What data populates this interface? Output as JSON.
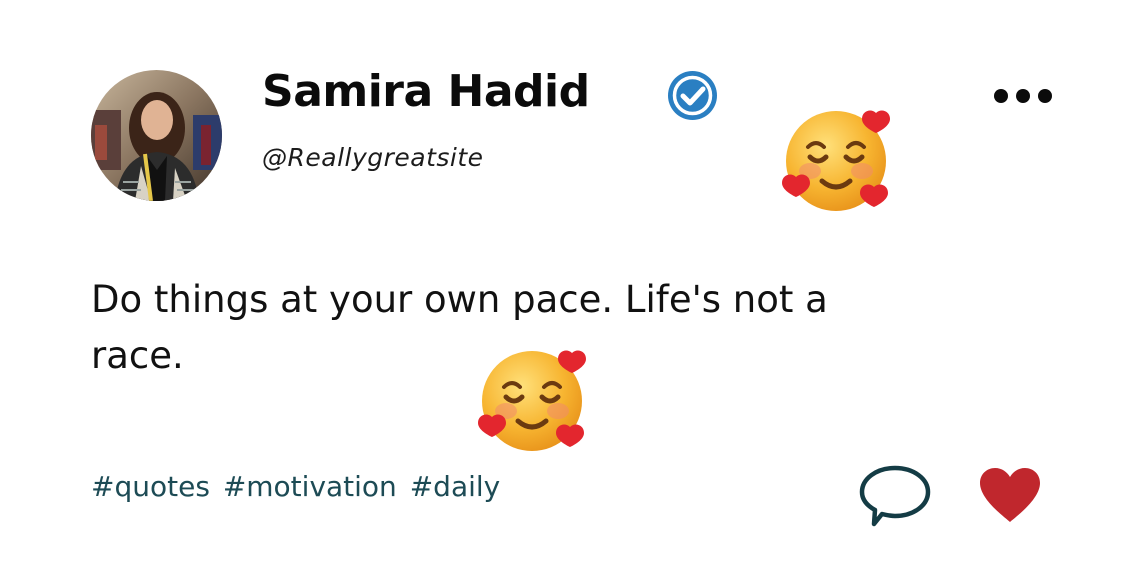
{
  "post": {
    "author_name": "Samira Hadid",
    "author_handle": "@Reallygreatsite",
    "verified": true,
    "text": "Do things at your own pace. Life's not a race.",
    "hashtags": [
      "#quotes",
      "#motivation",
      "#daily"
    ]
  },
  "icons": {
    "verified": "verified-badge-icon",
    "more": "more-options-icon",
    "comment": "comment-icon",
    "like": "heart-icon",
    "emoji": "smiling-face-with-hearts-emoji"
  },
  "colors": {
    "verified_badge": "#2a7fc2",
    "hashtag_text": "#1d4b55",
    "comment_icon": "#143c45",
    "heart_icon": "#c0272d",
    "name_text": "#0b0b0b",
    "emoji_face": "#f7b531"
  }
}
